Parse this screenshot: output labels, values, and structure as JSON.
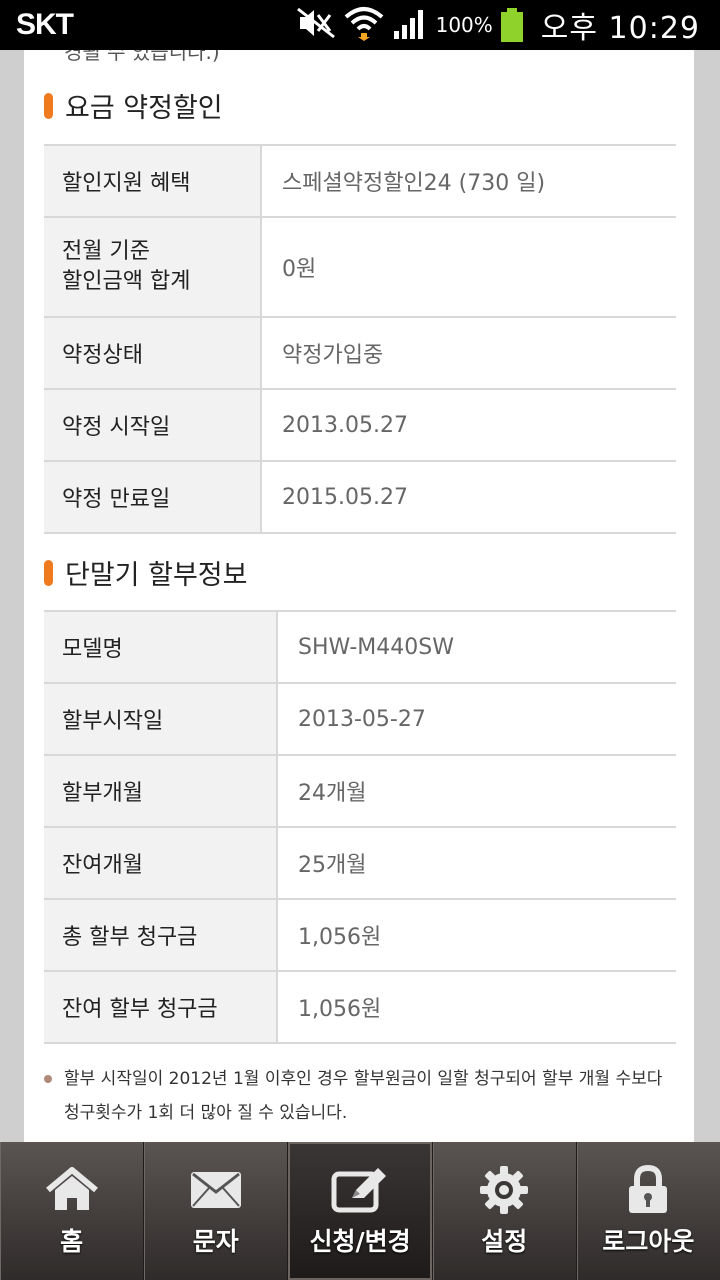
{
  "status_bar": {
    "carrier": "SKT",
    "battery_percent": "100%",
    "battery_level": 1.0,
    "time": "오후 10:29"
  },
  "top_cut_text": "경될 수 있습니다.)",
  "discount_section": {
    "title": "요금 약정할인",
    "rows": [
      {
        "label": "할인지원 혜택",
        "value": "스페셜약정할인24 (730 일)"
      },
      {
        "label": "전월 기준\n할인금액 합계",
        "value": "0원"
      },
      {
        "label": "약정상태",
        "value": "약정가입중"
      },
      {
        "label": "약정 시작일",
        "value": "2013.05.27"
      },
      {
        "label": "약정 만료일",
        "value": "2015.05.27"
      }
    ]
  },
  "installment_section": {
    "title": "단말기 할부정보",
    "rows": [
      {
        "label": "모델명",
        "value": "SHW-M440SW"
      },
      {
        "label": "할부시작일",
        "value": "2013-05-27"
      },
      {
        "label": "할부개월",
        "value": "24개월"
      },
      {
        "label": "잔여개월",
        "value": "25개월"
      },
      {
        "label": "총 할부 청구금",
        "value": "1,056원"
      },
      {
        "label": "잔여 할부 청구금",
        "value": "1,056원"
      }
    ]
  },
  "note": "할부 시작일이 2012년 1월 이후인 경우 할부원금이 일할 청구되어 할부 개월 수보다 청구횟수가 1회 더 많아 질 수 있습니다.",
  "tabs": [
    {
      "label": "홈",
      "icon": "home-icon"
    },
    {
      "label": "문자",
      "icon": "envelope-icon"
    },
    {
      "label": "신청/변경",
      "icon": "edit-icon",
      "active": true
    },
    {
      "label": "설정",
      "icon": "gear-icon"
    },
    {
      "label": "로그아웃",
      "icon": "lock-icon"
    }
  ],
  "colors": {
    "accent_bar": "#f07a1e",
    "battery": "#8fd22b"
  }
}
